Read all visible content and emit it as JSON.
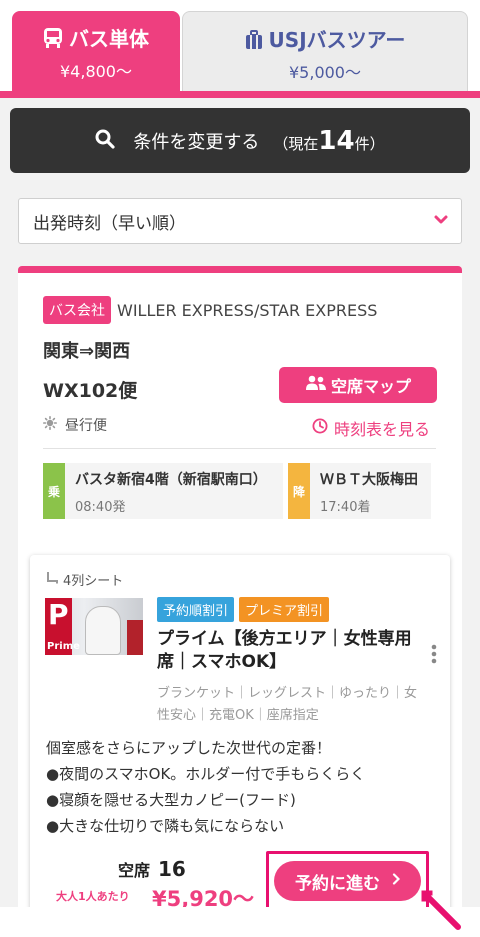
{
  "tabs": [
    {
      "title": "バス単体",
      "price": "¥4,800～"
    },
    {
      "title": "USJバスツアー",
      "price": "¥5,000～"
    }
  ],
  "search": {
    "label": "条件を変更する",
    "current_prefix": "（現在",
    "count": "14",
    "current_suffix": "件）"
  },
  "sort": {
    "selected": "出発時刻（早い順）"
  },
  "result": {
    "company_badge": "バス会社",
    "company_name": "WILLER EXPRESS/STAR EXPRESS",
    "route": "関東⇒関西",
    "bus_number": "WX102便",
    "seatmap_label": "空席マップ",
    "service_type": "昼行便",
    "timetable_label": "時刻表を見る",
    "boarding": {
      "tag": "乗",
      "stop": "バスタ新宿4階（新宿駅南口）",
      "time": "08:40発"
    },
    "alighting": {
      "tag": "降",
      "stop": "ＷＢＴ大阪梅田",
      "time": "17:40着"
    },
    "plan": {
      "seat_type": "4列シート",
      "thumb_letter": "P",
      "thumb_word": "Prime",
      "discounts": [
        "予約順割引",
        "プレミア割引"
      ],
      "title": "プライム【後方エリア｜女性専用席｜スマホOK】",
      "amenities": "ブランケット｜レッグレスト｜ゆったり｜女性安心｜充電OK｜座席指定",
      "description": [
        "個室感をさらにアップした次世代の定番！",
        "●夜間のスマホOK。ホルダー付で手もらくらく",
        "●寝顔を隠せる大型カノピー(フード)",
        "●大きな仕切りで隣も気にならない"
      ],
      "vacancy_label": "空席",
      "vacancy_count": "16",
      "per_person_label": "大人1人あたり",
      "price": "¥5,920～",
      "reserve_label": "予約に進む"
    }
  },
  "colors": {
    "accent": "#ee3f7f",
    "dark": "#333333",
    "tour": "#4d5aa0"
  }
}
